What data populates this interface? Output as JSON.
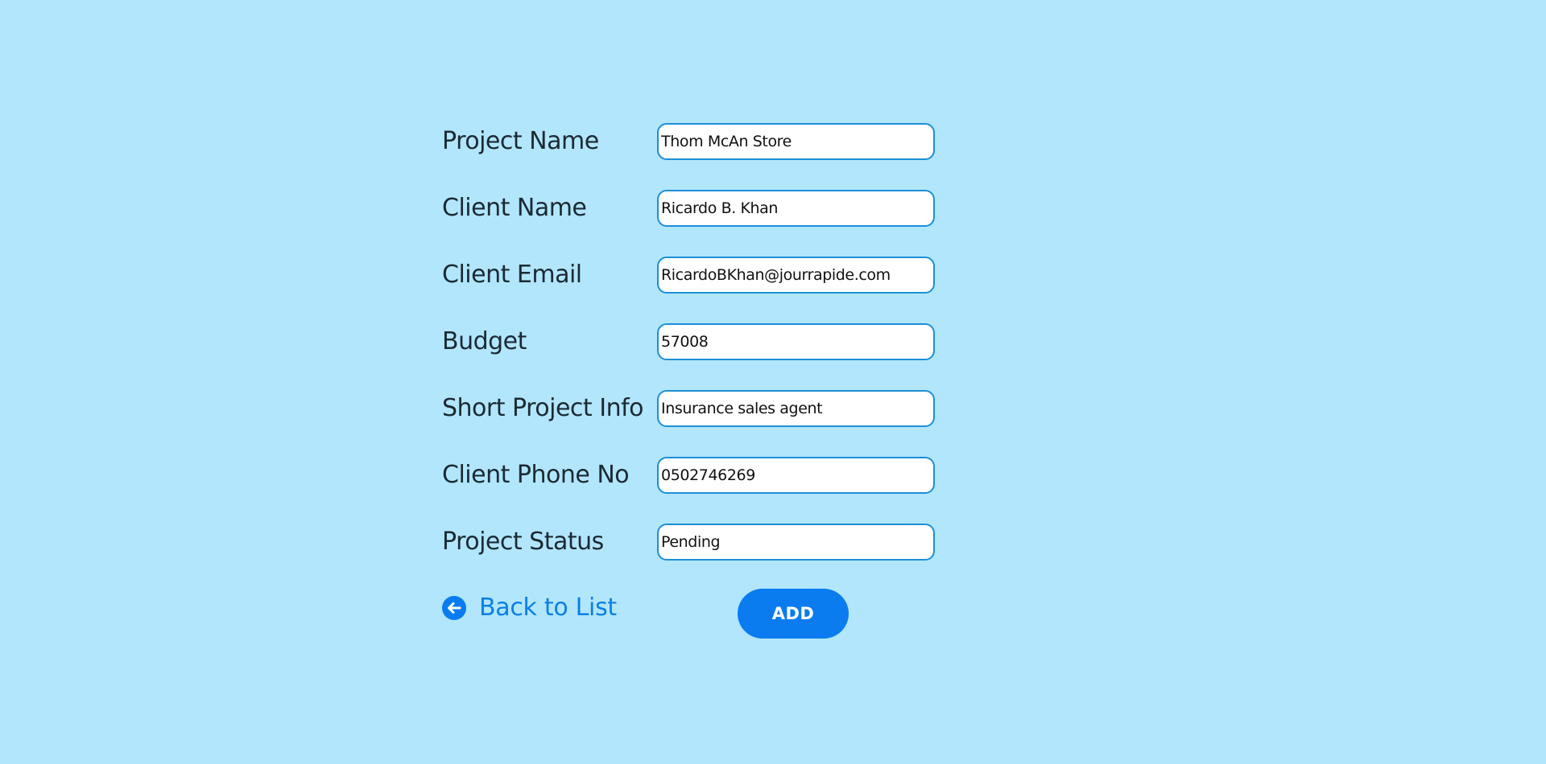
{
  "form": {
    "fields": [
      {
        "label": "Project Name",
        "value": "Thom McAn Store"
      },
      {
        "label": "Client Name",
        "value": "Ricardo B. Khan"
      },
      {
        "label": "Client Email",
        "value": "RicardoBKhan@jourrapide.com"
      },
      {
        "label": "Budget",
        "value": "57008"
      },
      {
        "label": "Short Project Info",
        "value": "Insurance sales agent"
      },
      {
        "label": "Client Phone No",
        "value": "0502746269"
      },
      {
        "label": "Project Status",
        "value": "Pending"
      }
    ]
  },
  "actions": {
    "back_label": "Back to List",
    "back_icon": "arrow-left-circle-icon",
    "add_label": "ADD"
  },
  "colors": {
    "background": "#b2e6fc",
    "accent": "#0a7cf0",
    "field_border": "#1c8fd6",
    "label_text": "#1b2a35"
  }
}
